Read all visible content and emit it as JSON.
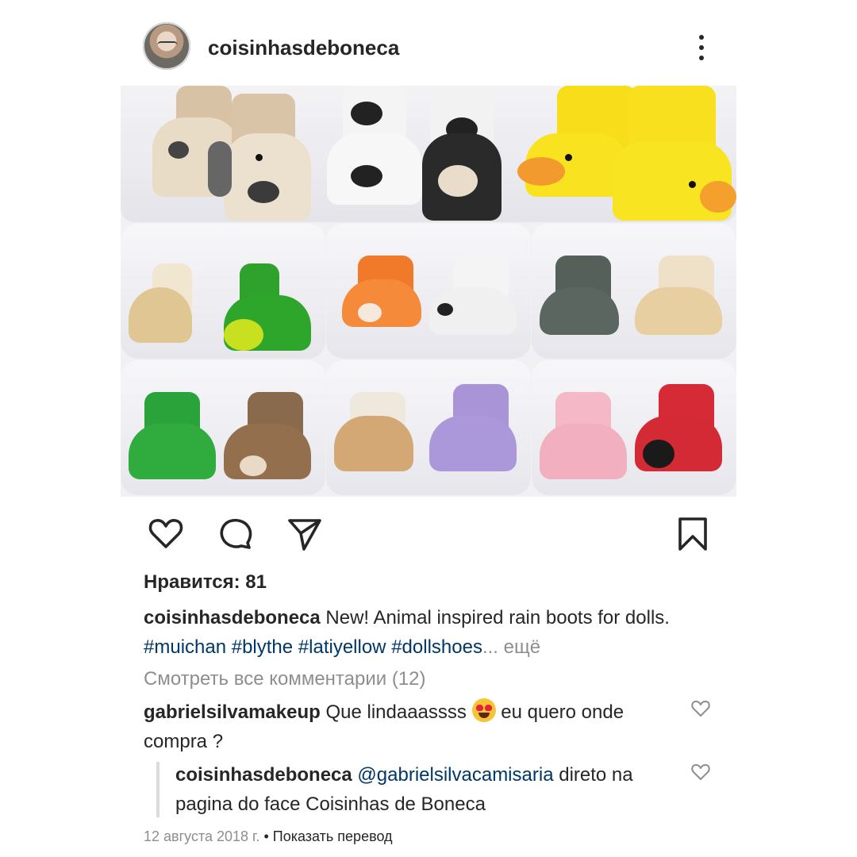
{
  "post": {
    "username": "coisinhasdeboneca",
    "likes_text": "Нравится: 81",
    "caption": {
      "author": "coisinhasdeboneca",
      "text": "New! Animal inspired rain boots for dolls.",
      "hashtags": [
        "#muichan",
        "#blythe",
        "#latiyellow",
        "#dollshoes"
      ],
      "ellipsis": "...",
      "more_label": "ещё"
    },
    "view_comments": "Смотреть все комментарии (12)",
    "comments": [
      {
        "author": "gabrielsilvamakeup",
        "text_before_emoji": "Que lindaaassss",
        "emoji": "heart-eyes-emoji",
        "text_after_emoji": "eu quero onde compra ?"
      },
      {
        "author": "coisinhasdeboneca",
        "mention": "@gabrielsilvacamisaria",
        "text": "direto na pagina do face Coisinhas de Boneca"
      }
    ],
    "date": "12 августа 2018 г.",
    "separator": "•",
    "translate_label": "Показать перевод"
  },
  "icons": {
    "header_more": "more-vertical-icon",
    "like": "heart-icon",
    "comment": "comment-bubble-icon",
    "share": "paper-plane-icon",
    "save": "bookmark-icon",
    "comment_like": "heart-outline-icon"
  },
  "colors": {
    "text": "#262626",
    "secondary": "#8e8e8e",
    "link": "#00376b"
  }
}
